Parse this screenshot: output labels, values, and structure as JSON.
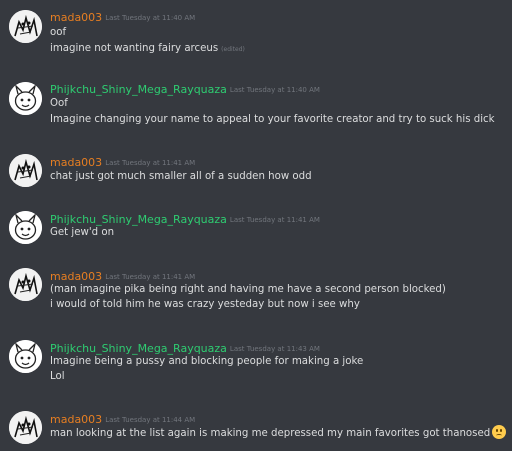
{
  "colors": {
    "background": "#36393f",
    "username_mada": "#e67e22",
    "username_phijkchu": "#2ecc71",
    "message_text": "#dcddde",
    "timestamp": "#72767d"
  },
  "messages": [
    {
      "author": "mada003",
      "timestamp": "Last Tuesday at 11:40 AM",
      "avatar_icon": "sketch-avatar-icon",
      "lines": [
        "oof",
        "imagine not wanting fairy arceus"
      ],
      "edited_label": "(edited)"
    },
    {
      "author": "Phijkchu_Shiny_Mega_Rayquaza",
      "timestamp": "Last Tuesday at 11:40 AM",
      "avatar_icon": "cartoon-avatar-icon",
      "lines": [
        "Oof",
        "Imagine changing your name to appeal to your favorite creator and try to suck his dick"
      ]
    },
    {
      "author": "mada003",
      "timestamp": "Last Tuesday at 11:41 AM",
      "avatar_icon": "sketch-avatar-icon",
      "lines": [
        "chat just got much smaller all of a sudden how odd"
      ]
    },
    {
      "author": "Phijkchu_Shiny_Mega_Rayquaza",
      "timestamp": "Last Tuesday at 11:41 AM",
      "avatar_icon": "cartoon-avatar-icon",
      "lines": [
        "Get jew'd on"
      ]
    },
    {
      "author": "mada003",
      "timestamp": "Last Tuesday at 11:41 AM",
      "avatar_icon": "sketch-avatar-icon",
      "lines": [
        "(man imagine pika being right and having me have a second person blocked)",
        "i would of told him he was crazy yesteday but now i see why"
      ]
    },
    {
      "author": "Phijkchu_Shiny_Mega_Rayquaza",
      "timestamp": "Last Tuesday at 11:43 AM",
      "avatar_icon": "cartoon-avatar-icon",
      "lines": [
        "Imagine being a pussy and blocking people for making a joke",
        "Lol"
      ]
    },
    {
      "author": "mada003",
      "timestamp": "Last Tuesday at 11:44 AM",
      "avatar_icon": "sketch-avatar-icon",
      "lines": [
        "man looking at the list again is making me depressed my main favorites got thanosed"
      ],
      "emoji": "slightly-frowning-face-icon"
    }
  ]
}
